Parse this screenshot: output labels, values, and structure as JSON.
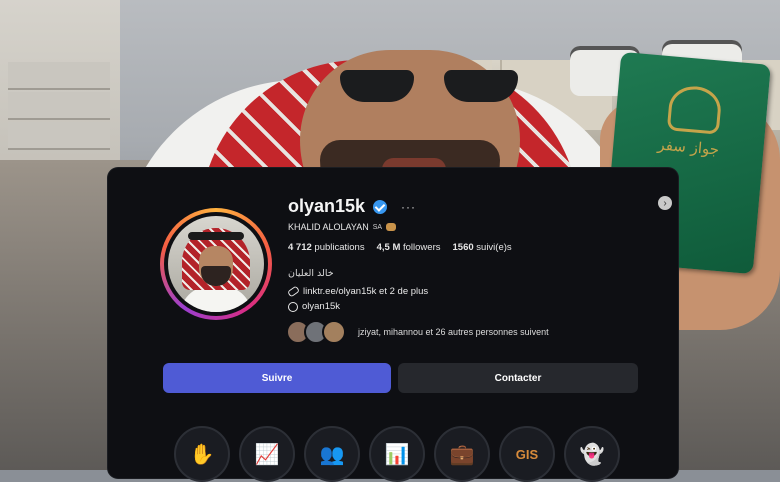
{
  "profile": {
    "username": "olyan15k",
    "more_glyph": "···",
    "full_name": "KHALID ALOLAYAN",
    "flag_text": "SA",
    "stats": {
      "posts_value": "4 712",
      "posts_label": "publications",
      "followers_value": "4,5 M",
      "followers_label": "followers",
      "following_value": "1560",
      "following_label": "suivi(e)s"
    },
    "bio_arabic": "خالد العليان",
    "link_text": "linktr.ee/olyan15k et 2 de plus",
    "threads_handle": "olyan15k",
    "followed_by_text": "jziyat, mihannou et 26 autres personnes suivent"
  },
  "buttons": {
    "follow_label": "Suivre",
    "contact_label": "Contacter"
  },
  "highlights": [
    {
      "icon": "handshake-icon"
    },
    {
      "icon": "growth-chart-icon"
    },
    {
      "icon": "group-icon"
    },
    {
      "icon": "presentation-icon"
    },
    {
      "icon": "briefcase-icon"
    },
    {
      "icon": "logo-icon",
      "text": "GIS"
    },
    {
      "icon": "snapchat-icon"
    }
  ],
  "passport": {
    "title": "جواز سفر"
  },
  "colors": {
    "card_bg": "#0e0f13",
    "follow_button": "#4f5bd5",
    "contact_button": "#26282d",
    "verified": "#3797f0",
    "highlight_accent": "#d88b3b"
  }
}
